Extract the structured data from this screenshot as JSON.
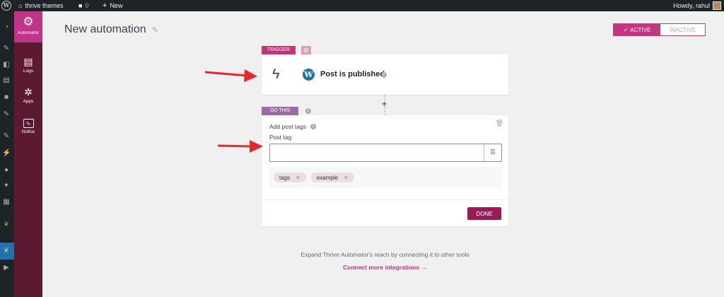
{
  "adminbar": {
    "site_name": "thrive themes",
    "comments_count": "0",
    "new_label": "New",
    "howdy": "Howdy, rahul"
  },
  "automator_sidebar": {
    "logo_label": "Automator",
    "items": [
      {
        "label": "Logs",
        "icon": "logs-icon"
      },
      {
        "label": "Apps",
        "icon": "apps-icon"
      },
      {
        "label": "Notice",
        "icon": "notice-icon"
      }
    ]
  },
  "header": {
    "title": "New automation",
    "toggle": {
      "active_label": "ACTIVE",
      "inactive_label": "INACTIVE"
    }
  },
  "trigger": {
    "tag_label": "TRIGGER",
    "title": "Post is published"
  },
  "action": {
    "tag_label": "DO THIS",
    "title": "Add post tags",
    "field_label": "Post tag",
    "field_value": "",
    "tags": [
      "tags",
      "example"
    ],
    "done_label": "DONE"
  },
  "footer": {
    "expand_text": "Expand Thrive Automator's reach by connecting it to other tools",
    "connect_text": "Connect more integrations →"
  },
  "colors": {
    "accent": "#c0367a",
    "sidebar_bg": "#5b1a32",
    "done_bg": "#9b1a57",
    "arrow": "#e8262b"
  }
}
